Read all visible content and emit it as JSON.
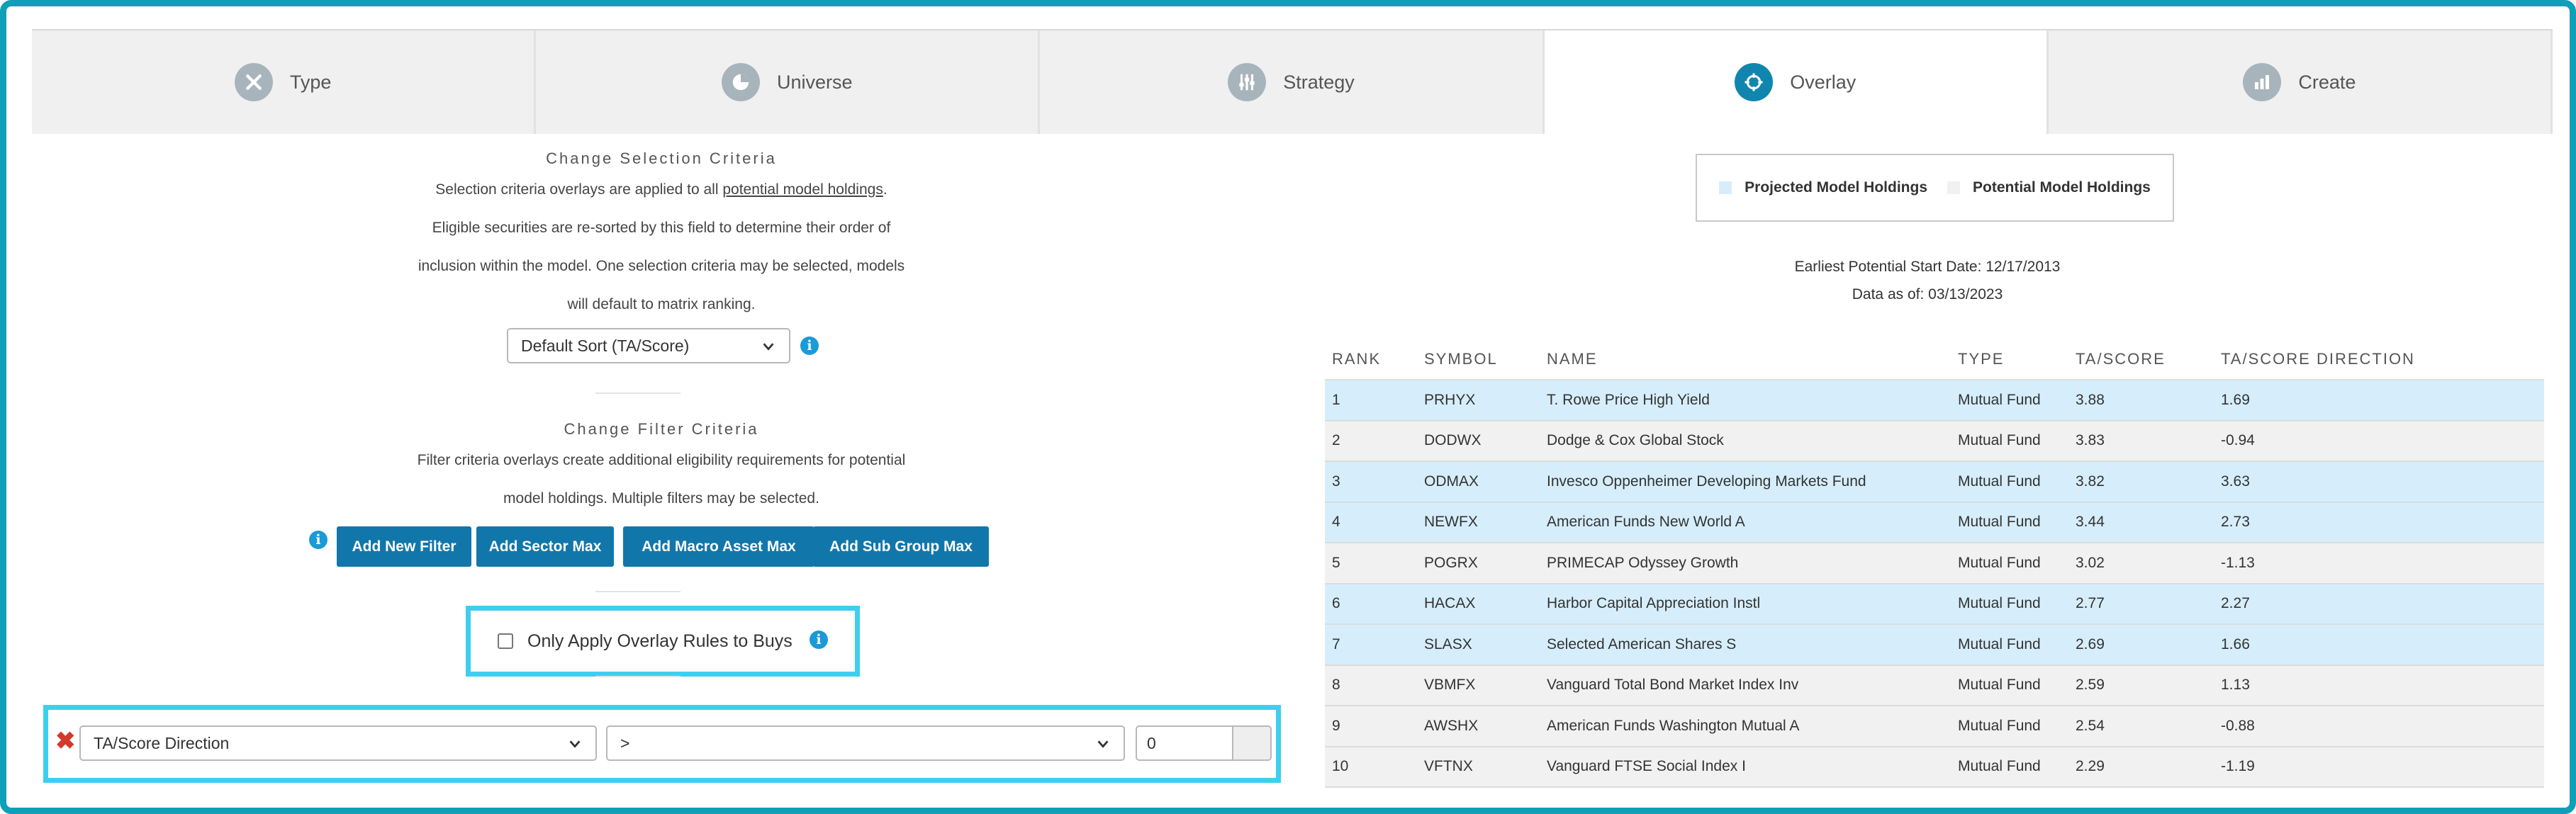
{
  "tabs": [
    {
      "label": "Type",
      "icon": "tools-icon",
      "active": false
    },
    {
      "label": "Universe",
      "icon": "pie-chart-icon",
      "active": false
    },
    {
      "label": "Strategy",
      "icon": "sliders-icon",
      "active": false
    },
    {
      "label": "Overlay",
      "icon": "target-icon",
      "active": true
    },
    {
      "label": "Create",
      "icon": "bar-chart-icon",
      "active": false
    }
  ],
  "selection": {
    "title": "Change Selection Criteria",
    "line1_pre": "Selection criteria overlays are applied to all ",
    "line1_link": "potential model holdings",
    "line1_post": ".",
    "line2": "Eligible securities are re-sorted by this field to determine their order of",
    "line3": "inclusion within the model. One selection criteria may be selected, models",
    "line4": "will default to matrix ranking.",
    "dropdown_value": "Default Sort (TA/Score)"
  },
  "filter": {
    "title": "Change Filter Criteria",
    "line1": "Filter criteria overlays create additional eligibility requirements for potential",
    "line2": "model holdings. Multiple filters may be selected.",
    "buttons": [
      "Add New Filter",
      "Add Sector Max",
      "Add Macro Asset Max",
      "Add Sub Group Max"
    ]
  },
  "overlay_checkbox": {
    "label": "Only Apply Overlay Rules to Buys",
    "checked": false
  },
  "filter_row": {
    "field": "TA/Score Direction",
    "operator": ">",
    "value": "0"
  },
  "legend": {
    "items": [
      {
        "label": "Projected Model Holdings",
        "color": "#d6eefb"
      },
      {
        "label": "Potential Model Holdings",
        "color": "#f1f1f1"
      }
    ]
  },
  "meta": {
    "start_date": "Earliest Potential Start Date: 12/17/2013",
    "data_as_of": "Data as of: 03/13/2023"
  },
  "table": {
    "headers": [
      "RANK",
      "SYMBOL",
      "NAME",
      "TYPE",
      "TA/SCORE",
      "TA/SCORE DIRECTION"
    ],
    "rows": [
      {
        "rank": "1",
        "symbol": "PRHYX",
        "name": "T. Rowe Price High Yield",
        "type": "Mutual Fund",
        "score": "3.88",
        "direction": "1.69",
        "status": "projected"
      },
      {
        "rank": "2",
        "symbol": "DODWX",
        "name": "Dodge & Cox Global Stock",
        "type": "Mutual Fund",
        "score": "3.83",
        "direction": "-0.94",
        "status": "potential"
      },
      {
        "rank": "3",
        "symbol": "ODMAX",
        "name": "Invesco Oppenheimer Developing Markets Fund",
        "type": "Mutual Fund",
        "score": "3.82",
        "direction": "3.63",
        "status": "projected"
      },
      {
        "rank": "4",
        "symbol": "NEWFX",
        "name": "American Funds New World A",
        "type": "Mutual Fund",
        "score": "3.44",
        "direction": "2.73",
        "status": "projected"
      },
      {
        "rank": "5",
        "symbol": "POGRX",
        "name": "PRIMECAP Odyssey Growth",
        "type": "Mutual Fund",
        "score": "3.02",
        "direction": "-1.13",
        "status": "potential"
      },
      {
        "rank": "6",
        "symbol": "HACAX",
        "name": "Harbor Capital Appreciation Instl",
        "type": "Mutual Fund",
        "score": "2.77",
        "direction": "2.27",
        "status": "projected"
      },
      {
        "rank": "7",
        "symbol": "SLASX",
        "name": "Selected American Shares S",
        "type": "Mutual Fund",
        "score": "2.69",
        "direction": "1.66",
        "status": "projected"
      },
      {
        "rank": "8",
        "symbol": "VBMFX",
        "name": "Vanguard Total Bond Market Index Inv",
        "type": "Mutual Fund",
        "score": "2.59",
        "direction": "1.13",
        "status": "potential"
      },
      {
        "rank": "9",
        "symbol": "AWSHX",
        "name": "American Funds Washington Mutual A",
        "type": "Mutual Fund",
        "score": "2.54",
        "direction": "-0.88",
        "status": "potential"
      },
      {
        "rank": "10",
        "symbol": "VFTNX",
        "name": "Vanguard FTSE Social Index I",
        "type": "Mutual Fund",
        "score": "2.29",
        "direction": "-1.19",
        "status": "potential"
      }
    ]
  }
}
